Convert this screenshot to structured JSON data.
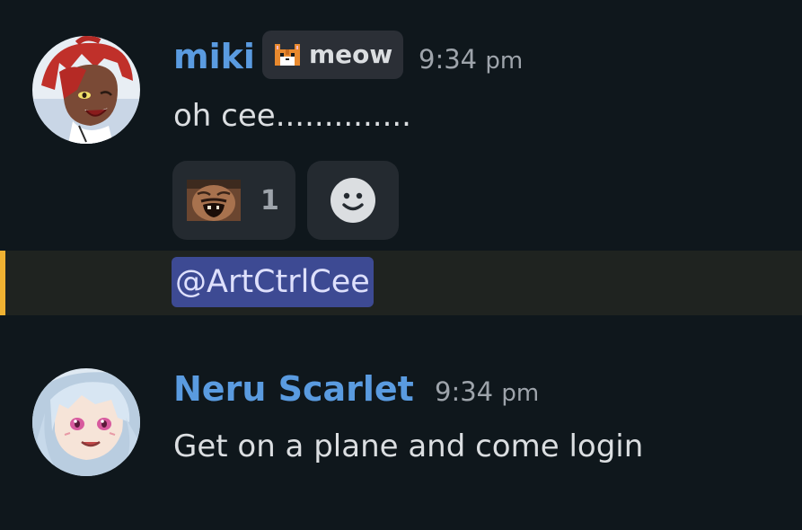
{
  "messages": [
    {
      "username": "miki",
      "tag": {
        "icon": "cat-icon",
        "label": "meow"
      },
      "time": "9:34",
      "ampm": "pm",
      "text": "oh cee..............",
      "reactions": [
        {
          "emoji": "laughing-man-emoji",
          "count": "1"
        }
      ],
      "add_reaction_icon": "smiley-icon",
      "mention": "@ArtCtrlCee"
    },
    {
      "username": "Neru Scarlet",
      "time": "9:34",
      "ampm": "pm",
      "text": "Get on a plane and come login"
    }
  ],
  "colors": {
    "background": "#0f171c",
    "username": "#5a9be0",
    "mention_highlight": "#3d4a93",
    "mention_bar": "#f0b232"
  }
}
